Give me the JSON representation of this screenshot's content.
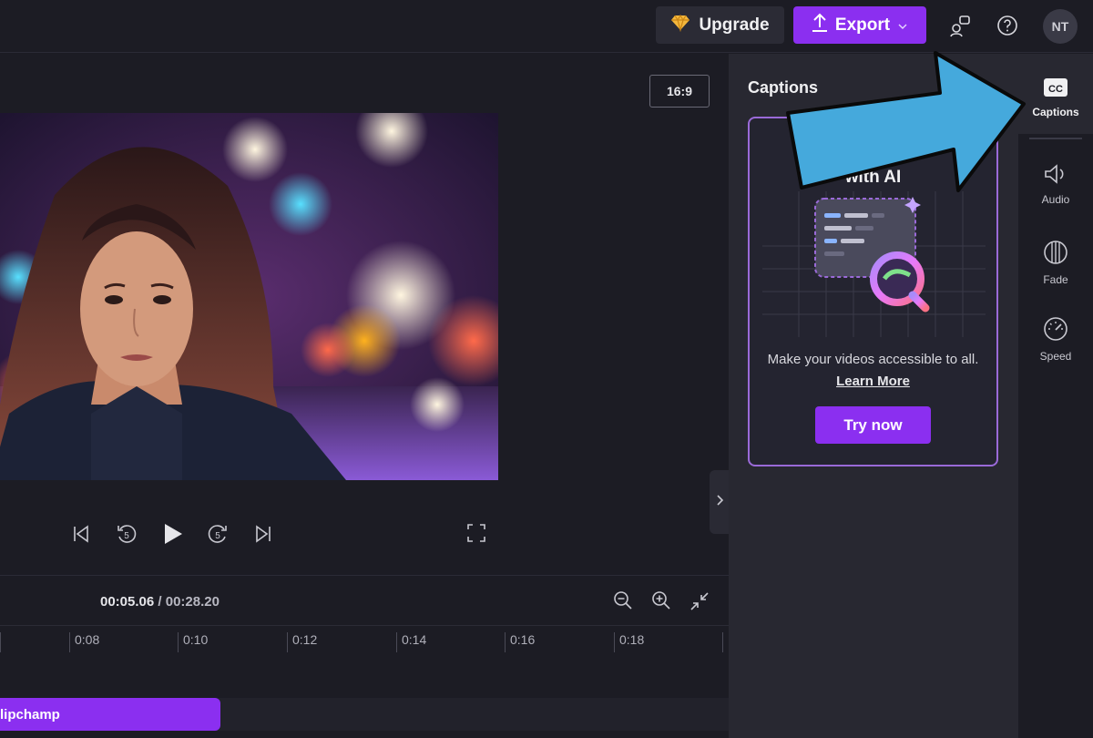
{
  "topbar": {
    "upgrade_label": "Upgrade",
    "export_label": "Export",
    "avatar_initials": "NT",
    "icons": [
      "diamond-icon",
      "upload-icon",
      "chevron-down-icon",
      "feedback-icon",
      "help-icon"
    ]
  },
  "preview": {
    "aspect_ratio": "16:9"
  },
  "timeline": {
    "current_time": "00:05.06",
    "separator": " / ",
    "total_time": "00:28.20",
    "ticks": [
      "0:08",
      "0:10",
      "0:12",
      "0:14",
      "0:16",
      "0:18"
    ],
    "clip_label": "lipchamp"
  },
  "panel": {
    "title": "Captions",
    "card": {
      "title_line1": "Ge",
      "title_line2": "with AI",
      "description": "Make your videos accessible to all.",
      "link": "Learn More",
      "button": "Try now"
    }
  },
  "sidebar": {
    "items": [
      {
        "label": "Captions",
        "icon": "cc-icon"
      },
      {
        "label": "Audio",
        "icon": "speaker-icon"
      },
      {
        "label": "Fade",
        "icon": "fade-icon"
      },
      {
        "label": "Speed",
        "icon": "speedometer-icon"
      }
    ]
  },
  "colors": {
    "accent": "#8b2ff0",
    "background": "#1c1c24",
    "panel": "#282831",
    "annotation_arrow": "#45a9dc"
  }
}
